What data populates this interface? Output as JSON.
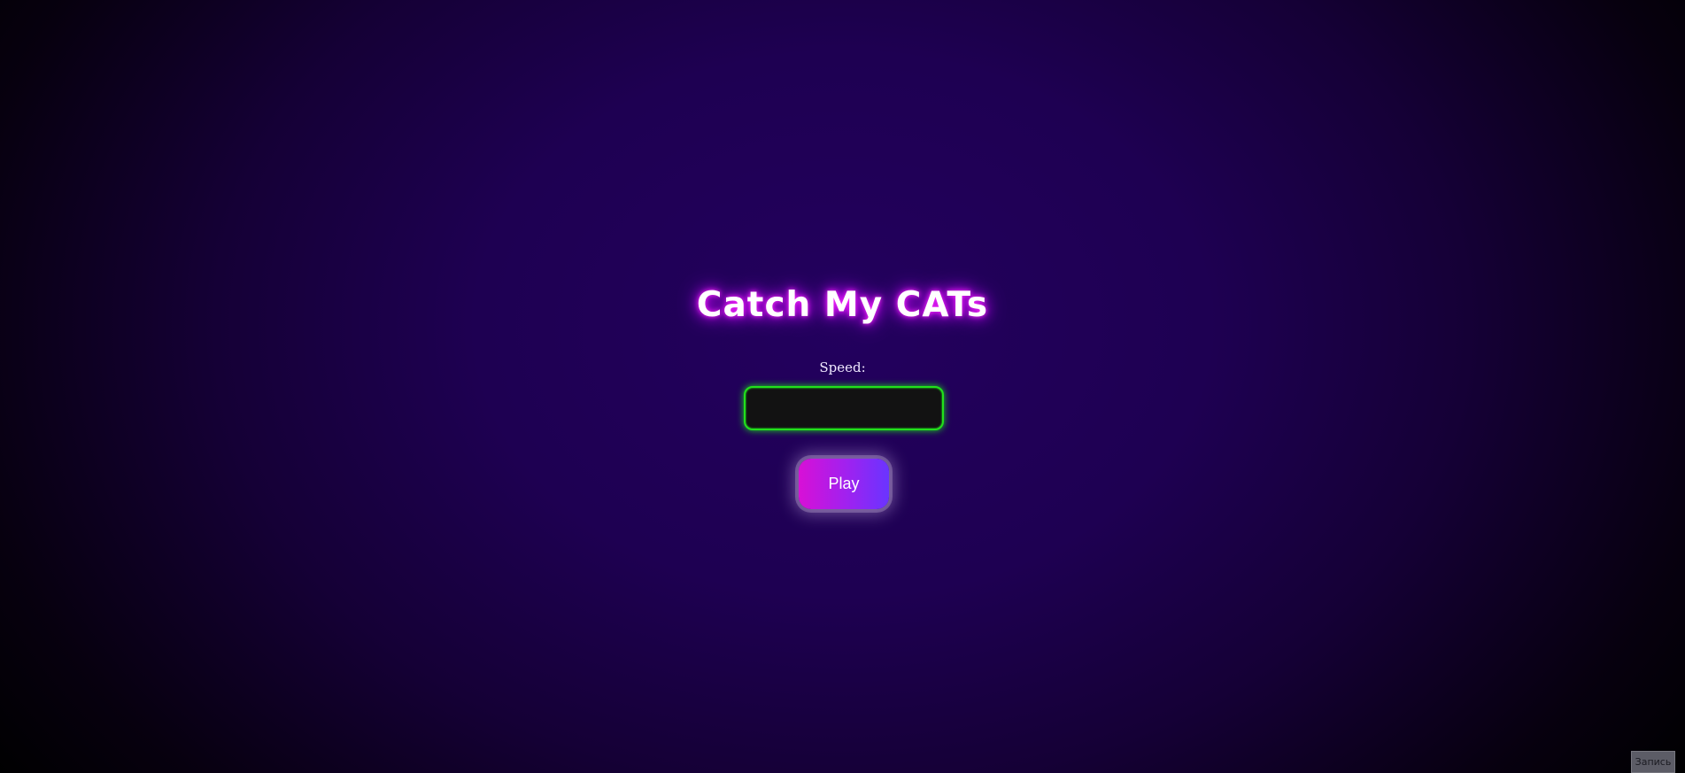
{
  "game": {
    "title": "Catch My CATs",
    "speed_label": "Speed:",
    "speed_value": "",
    "play_label": "Play"
  },
  "record": {
    "label": "Запись"
  },
  "colors": {
    "title_glow": "#d400ff",
    "input_border": "#22e01c",
    "play_gradient_start": "#d810d6",
    "play_gradient_end": "#6a34ff",
    "background_center": "#23005e"
  }
}
